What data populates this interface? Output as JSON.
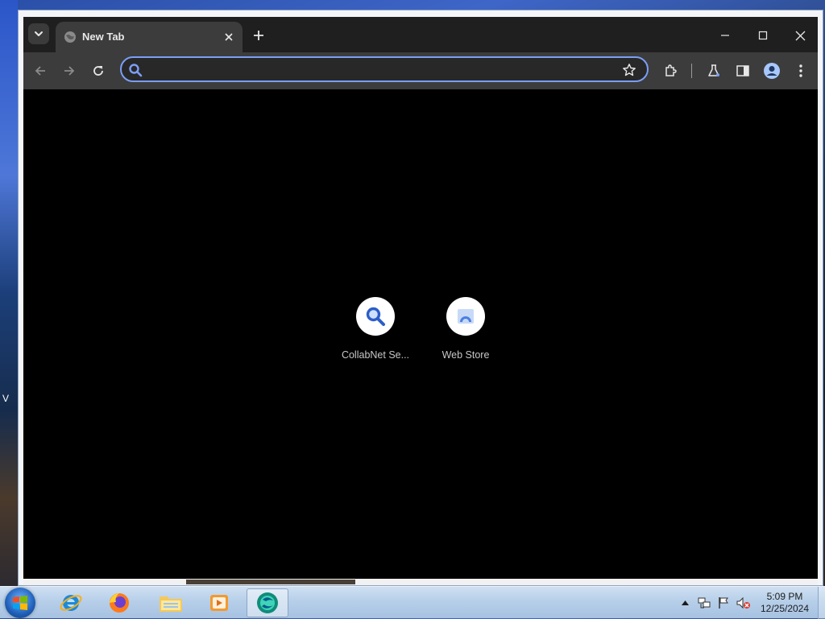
{
  "tab": {
    "title": "New Tab"
  },
  "omnibox": {
    "value": "",
    "placeholder": ""
  },
  "shortcuts": [
    {
      "label": "CollabNet Se...",
      "icon": "magnifier-icon"
    },
    {
      "label": "Web Store",
      "icon": "web-store-icon"
    }
  ],
  "taskbar": {
    "apps": [
      "internet-explorer",
      "firefox",
      "file-explorer",
      "media-player",
      "chrome-like-browser"
    ],
    "clock": {
      "time": "5:09 PM",
      "date": "12/25/2024"
    }
  },
  "desktop": {
    "edge_text": "V"
  },
  "colors": {
    "accent": "#7c9ef6",
    "content_bg": "#000000",
    "toolbar_bg": "#3c3c3c",
    "titlebar_bg": "#1f1f1f"
  }
}
